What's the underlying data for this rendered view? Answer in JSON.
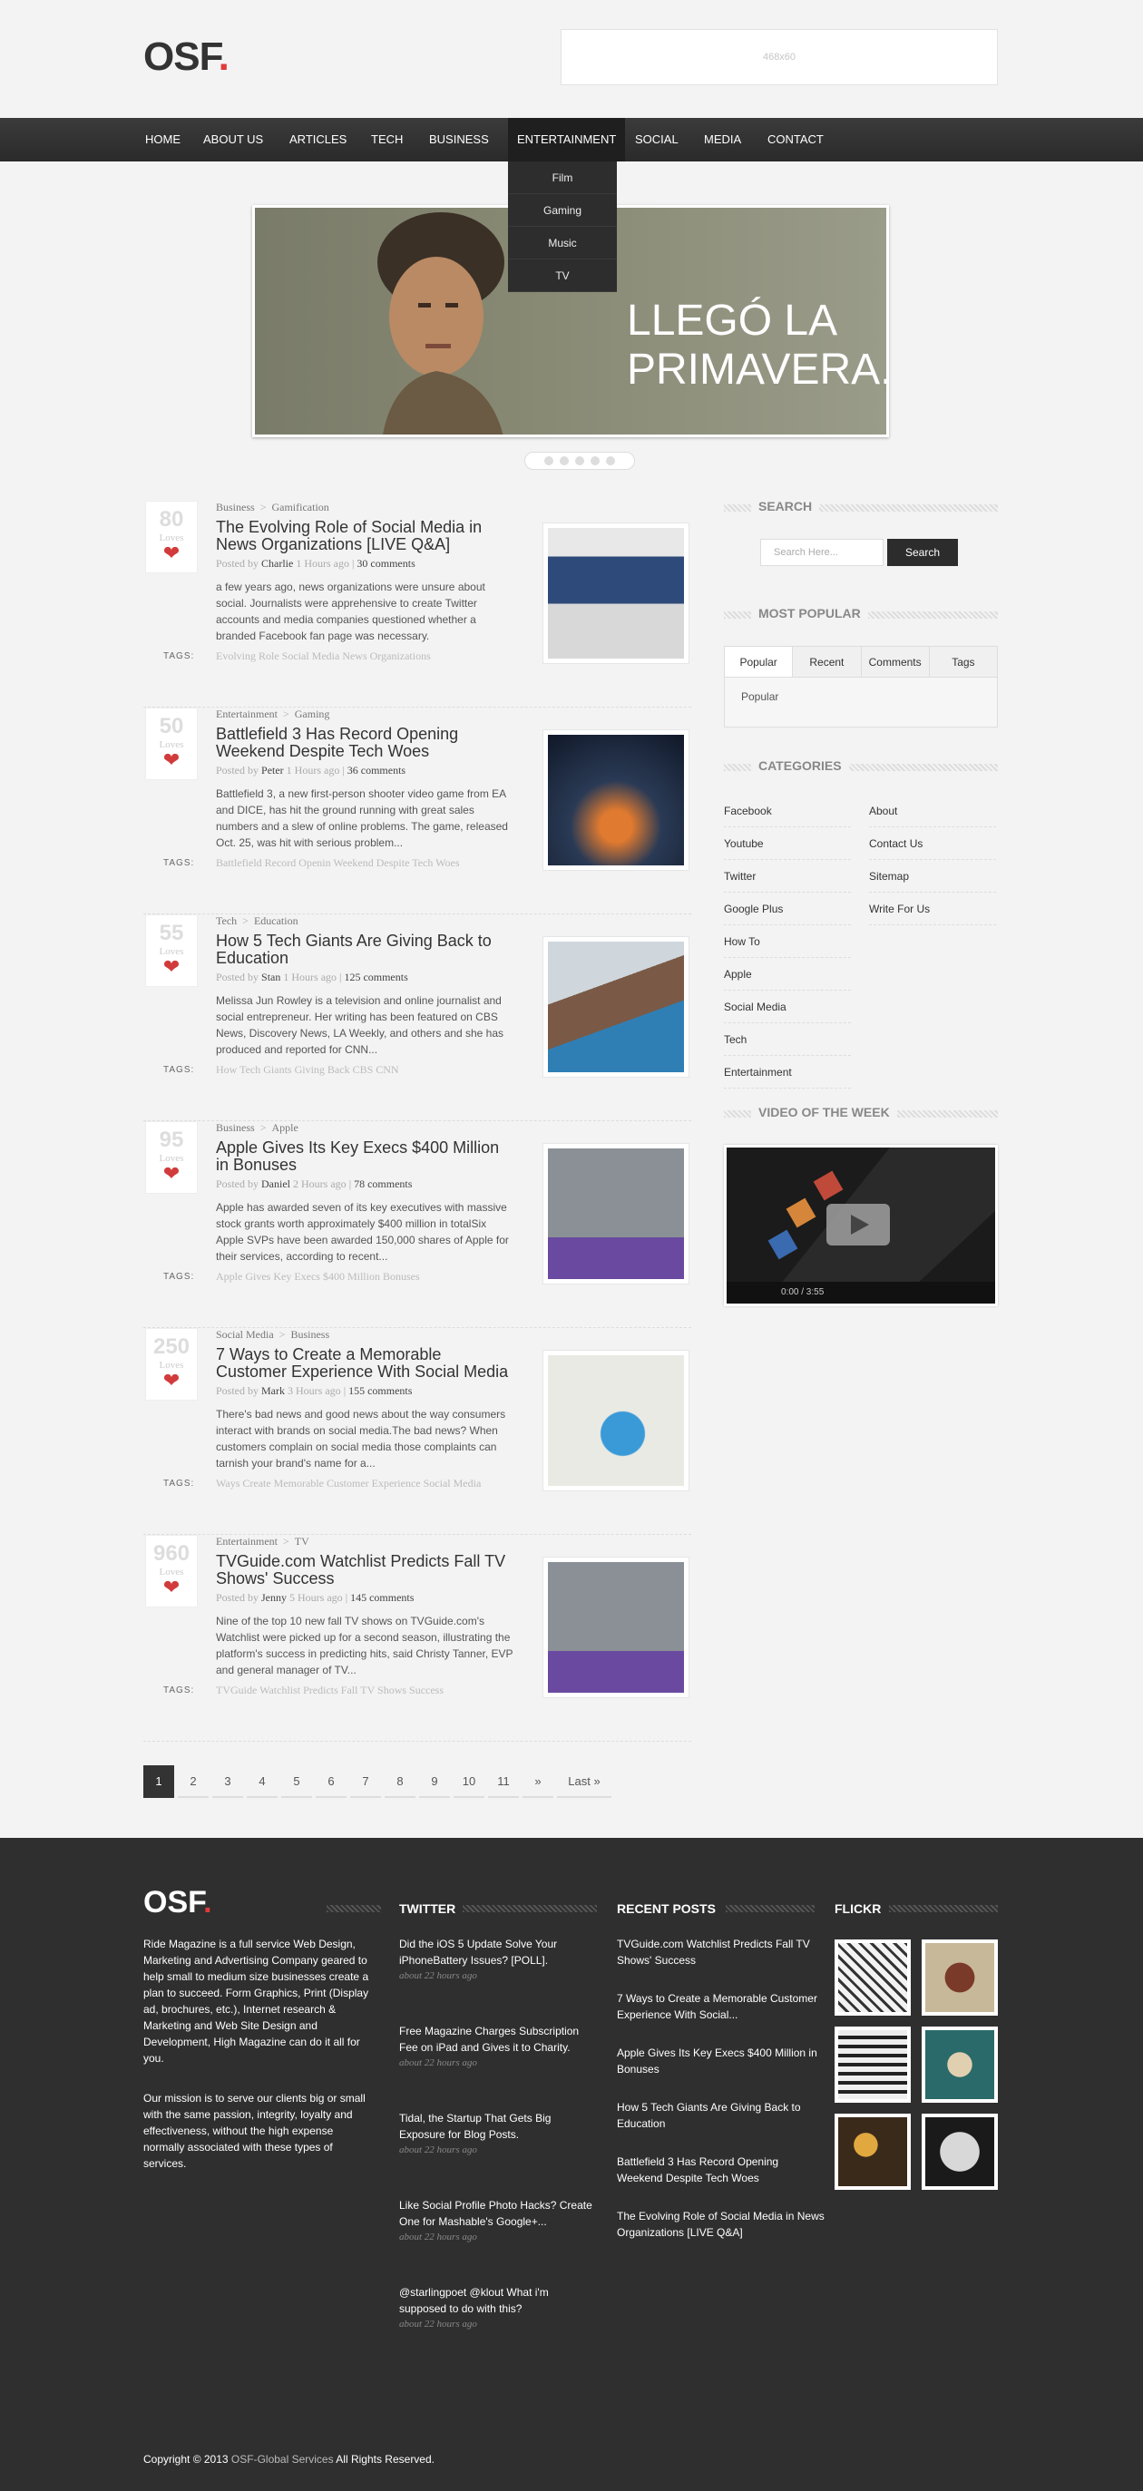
{
  "header": {
    "logo": "OSF",
    "ad_label": "468x60"
  },
  "nav": {
    "items": [
      "HOME",
      "ABOUT US",
      "ARTICLES",
      "TECH",
      "BUSINESS",
      "ENTERTAINMENT",
      "SOCIAL",
      "MEDIA",
      "CONTACT"
    ],
    "dropdown": [
      "Film",
      "Gaming",
      "Music",
      "TV"
    ]
  },
  "slider": {
    "caption_line1": "LLEGÓ LA",
    "caption_line2": "PRIMAVERA."
  },
  "posts": [
    {
      "loves": "80",
      "loves_label": "Loves",
      "cat1": "Business",
      "cat2": "Gamification",
      "title": "The Evolving Role of Social Media in News Organizations [LIVE Q&A]",
      "posted_by": "Posted by",
      "author": "Charlie",
      "time": "1 Hours ago",
      "comments": "30 comments",
      "excerpt": "a few years ago, news organizations were unsure about social. Journalists were apprehensive to create Twitter accounts and media companies questioned whether a branded Facebook fan page was necessary.",
      "tags_label": "TAGS:",
      "tags": "Evolving Role  Social Media  News Organizations"
    },
    {
      "loves": "50",
      "loves_label": "Loves",
      "cat1": "Entertainment",
      "cat2": "Gaming",
      "title": "Battlefield 3 Has Record Opening Weekend Despite Tech Woes",
      "posted_by": "Posted by",
      "author": "Peter",
      "time": "1 Hours ago",
      "comments": "36 comments",
      "excerpt": "Battlefield 3, a new first-person shooter video game from EA and DICE, has hit the ground running with great sales numbers and a slew of online problems. The game, released Oct. 25, was hit with serious problem...",
      "tags_label": "TAGS:",
      "tags": "Battlefield  Record Openin  Weekend  Despite  Tech Woes"
    },
    {
      "loves": "55",
      "loves_label": "Loves",
      "cat1": "Tech",
      "cat2": "Education",
      "title": "How 5 Tech Giants Are Giving Back to Education",
      "posted_by": "Posted by",
      "author": "Stan",
      "time": "1 Hours ago",
      "comments": "125 comments",
      "excerpt": "Melissa Jun Rowley is a television and online journalist and social entrepreneur. Her writing has been featured on CBS News, Discovery News, LA Weekly, and others and she has produced and reported for CNN...",
      "tags_label": "TAGS:",
      "tags": "How  Tech Giants  Giving Back  CBS  CNN"
    },
    {
      "loves": "95",
      "loves_label": "Loves",
      "cat1": "Business",
      "cat2": "Apple",
      "title": "Apple Gives Its Key Execs $400 Million in Bonuses",
      "posted_by": "Posted by",
      "author": "Daniel",
      "time": "2 Hours ago",
      "comments": "78 comments",
      "excerpt": "Apple has awarded seven of its key executives with massive stock grants worth approximately $400 million in totalSix Apple SVPs have been awarded 150,000 shares of Apple for their services, according to recent...",
      "tags_label": "TAGS:",
      "tags": "Apple  Gives  Key Execs  $400 Million  Bonuses"
    },
    {
      "loves": "250",
      "loves_label": "Loves",
      "cat1": "Social Media",
      "cat2": "Business",
      "title": "7 Ways to Create a Memorable Customer Experience With Social Media",
      "posted_by": "Posted by",
      "author": "Mark",
      "time": "3 Hours ago",
      "comments": "155 comments",
      "excerpt": "There's bad news and good news about the way consumers interact with brands on social media.The bad news? When customers complain on social media those complaints can tarnish your brand's name for a...",
      "tags_label": "TAGS:",
      "tags": "Ways  Create  Memorable  Customer  Experience  Social Media"
    },
    {
      "loves": "960",
      "loves_label": "Loves",
      "cat1": "Entertainment",
      "cat2": "TV",
      "title": "TVGuide.com Watchlist Predicts Fall TV Shows' Success",
      "posted_by": "Posted by",
      "author": "Jenny",
      "time": "5 Hours ago",
      "comments": "145 comments",
      "excerpt": "Nine of the top 10 new fall TV shows on TVGuide.com's Watchlist were picked up for a second season, illustrating the platform's success in predicting hits, said Christy Tanner, EVP and general manager of TV...",
      "tags_label": "TAGS:",
      "tags": "TVGuide  Watchlist  Predicts  Fall TV  Shows  Success"
    }
  ],
  "pagination": [
    "1",
    "2",
    "3",
    "4",
    "5",
    "6",
    "7",
    "8",
    "9",
    "10",
    "11",
    "»",
    "Last »"
  ],
  "sidebar": {
    "search_title": "SEARCH",
    "search_placeholder": "Search Here...",
    "search_button": "Search",
    "popular_title": "MOST POPULAR",
    "tabs": [
      "Popular",
      "Recent",
      "Comments",
      "Tags"
    ],
    "tab_content": "Popular",
    "categories_title": "CATEGORIES",
    "categories_left": [
      "Facebook",
      "Youtube",
      "Twitter",
      "Google Plus",
      "How To",
      "Apple",
      "Social Media",
      "Tech",
      "Entertainment"
    ],
    "categories_right": [
      "About",
      "Contact Us",
      "Sitemap",
      "Write For Us"
    ],
    "video_title": "VIDEO OF THE WEEK",
    "video_time": "0:00 / 3:55"
  },
  "footer": {
    "logo": "OSF",
    "about1": "Ride Magazine is a full service Web Design, Marketing and Advertising Company geared to help small to medium size businesses create a plan to succeed. Form Graphics, Print (Display ad, brochures, etc.), Internet research & Marketing and Web Site Design and Development, High Magazine can do it all for you.",
    "about2": "Our mission is to serve our clients big or small with the same passion, integrity, loyalty and effectiveness, without the high expense normally associated with these types of services.",
    "twitter_title": "TWITTER",
    "tweets": [
      {
        "text": "Did the iOS 5 Update Solve Your iPhoneBattery Issues? [POLL].",
        "time": "about 22 hours ago"
      },
      {
        "text": "Free Magazine Charges Subscription Fee on iPad and Gives it to Charity.",
        "time": "about 22 hours ago"
      },
      {
        "text": "Tidal, the Startup That Gets Big Exposure for Blog Posts.",
        "time": "about 22 hours ago"
      },
      {
        "text": "Like Social Profile Photo Hacks? Create One for Mashable's Google+...",
        "time": "about 22 hours ago"
      },
      {
        "text": "@starlingpoet @klout What i'm supposed to do with this?",
        "time": "about 22 hours ago"
      }
    ],
    "recent_title": "RECENT POSTS",
    "recent": [
      "TVGuide.com Watchlist Predicts Fall TV Shows' Success",
      "7 Ways to Create a Memorable Customer Experience With Social...",
      "Apple Gives Its Key Execs $400 Million in Bonuses",
      "How 5 Tech Giants Are Giving Back to Education",
      "Battlefield 3 Has Record Opening Weekend Despite Tech Woes",
      "The Evolving Role of Social Media in News Organizations [LIVE Q&A]"
    ],
    "flickr_title": "FLICKR",
    "copyright_prefix": "Copyright © 2013 ",
    "copyright_brand": "OSF-Global Services",
    "copyright_suffix": " All Rights Reserved."
  },
  "colors": {
    "accent": "#e03a3a",
    "nav_bg": "#333333",
    "footer_bg": "#2f2f2f",
    "heart": "#d23b3b"
  }
}
